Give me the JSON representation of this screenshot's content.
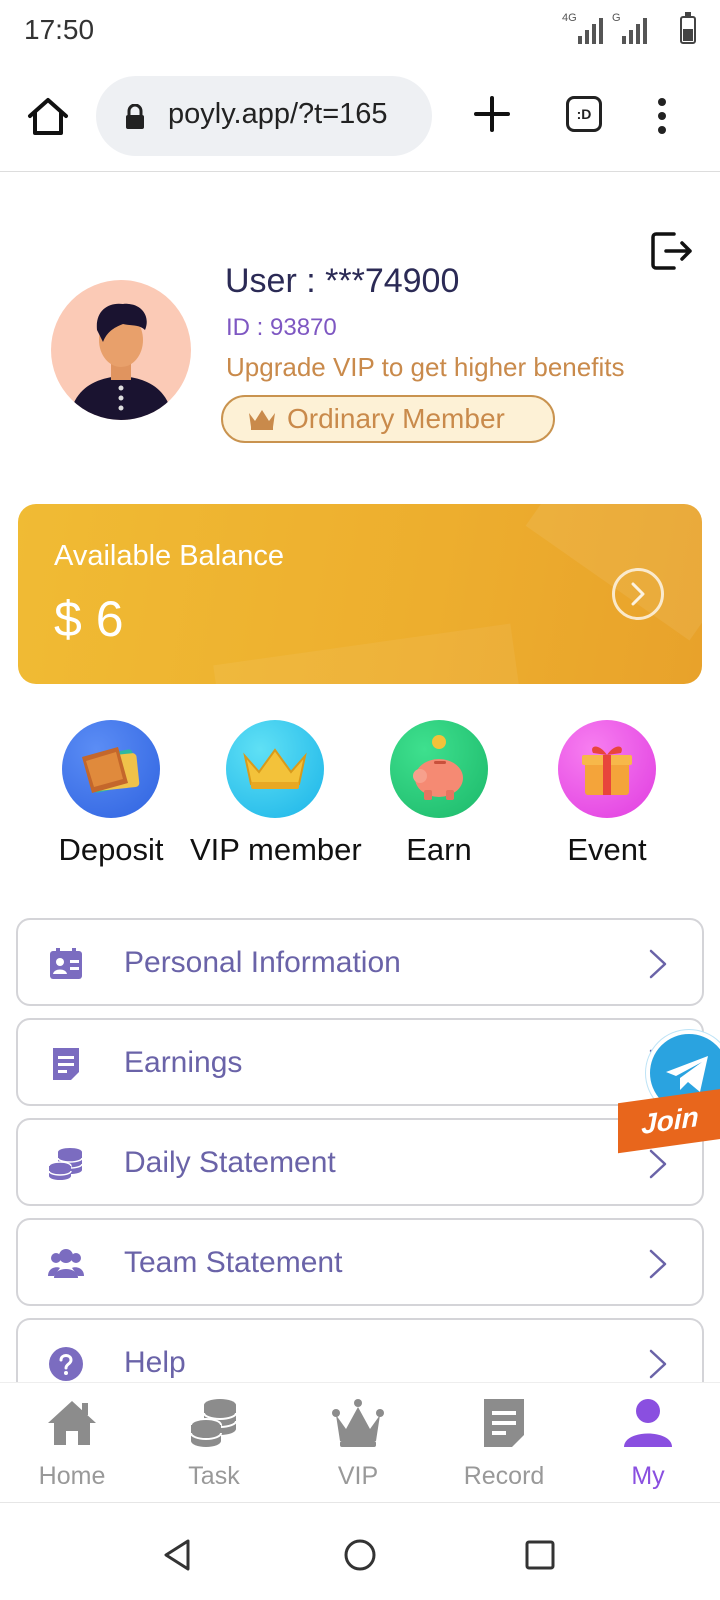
{
  "status_bar": {
    "time": "17:50",
    "network_1": "4G",
    "network_2": "G"
  },
  "browser": {
    "url": "poyly.app/?t=165",
    "tabs_icon_text": ":D"
  },
  "profile": {
    "user_label": "User : ***74900",
    "id_label": "ID : 93870",
    "upgrade_text": "Upgrade VIP to get higher benefits",
    "member_level": "Ordinary Member"
  },
  "balance": {
    "label": "Available Balance",
    "amount": "$ 6"
  },
  "quick_actions": [
    {
      "label": "Deposit",
      "icon": "wallet-icon"
    },
    {
      "label": "VIP member",
      "icon": "crown-icon"
    },
    {
      "label": "Earn",
      "icon": "piggy-bank-icon"
    },
    {
      "label": "Event",
      "icon": "gift-icon"
    }
  ],
  "menu": [
    {
      "label": "Personal Information",
      "icon": "id-card-icon"
    },
    {
      "label": "Earnings",
      "icon": "document-icon"
    },
    {
      "label": "Daily Statement",
      "icon": "coins-icon"
    },
    {
      "label": "Team Statement",
      "icon": "team-icon"
    },
    {
      "label": "Help",
      "icon": "help-icon"
    }
  ],
  "telegram": {
    "join_label": "Join"
  },
  "tabbar": [
    {
      "label": "Home",
      "icon": "home-icon",
      "active": false
    },
    {
      "label": "Task",
      "icon": "coins-icon",
      "active": false
    },
    {
      "label": "VIP",
      "icon": "crown-icon",
      "active": false
    },
    {
      "label": "Record",
      "icon": "document-icon",
      "active": false
    },
    {
      "label": "My",
      "icon": "user-icon",
      "active": true
    }
  ],
  "colors": {
    "accent_purple": "#8a4fe0",
    "menu_text": "#6a63a8",
    "balance_gold": "#edae2e",
    "member_tan": "#c98a4b"
  }
}
